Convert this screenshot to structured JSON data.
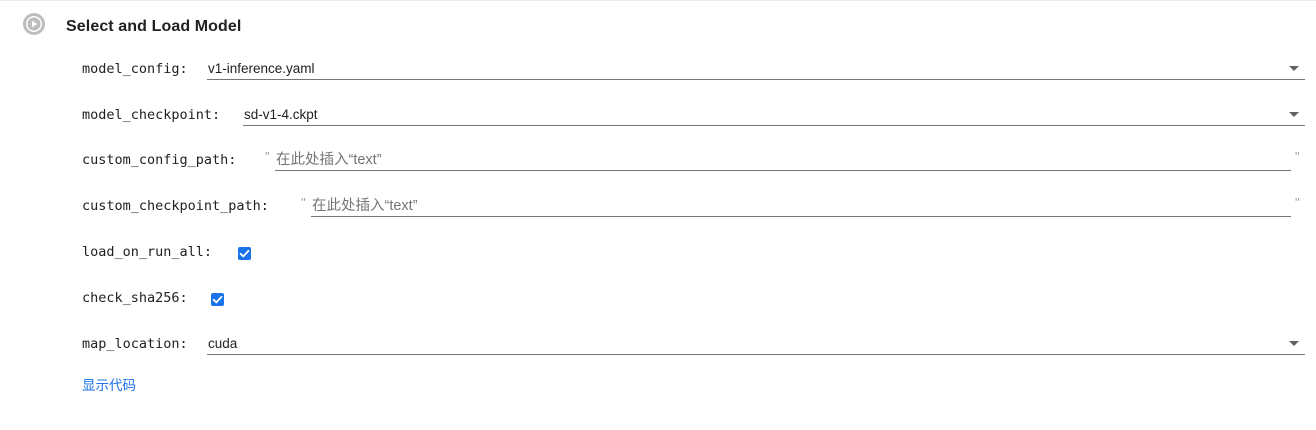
{
  "form": {
    "title": "Select and Load Model",
    "run_icon": "play-circle-icon"
  },
  "fields": {
    "model_config": {
      "label": "model_config:",
      "value": "v1-inference.yaml",
      "dropdown_icon": "caret-down-icon"
    },
    "model_checkpoint": {
      "label": "model_checkpoint:",
      "value": "sd-v1-4.ckpt",
      "dropdown_icon": "caret-down-icon"
    },
    "custom_config_path": {
      "label": "custom_config_path:",
      "value": "",
      "placeholder": "在此处插入“text”",
      "open_quote": "\"",
      "close_quote": "\""
    },
    "custom_checkpoint_path": {
      "label": "custom_checkpoint_path:",
      "value": "",
      "placeholder": "在此处插入“text”",
      "open_quote": "\"",
      "close_quote": "\""
    },
    "load_on_run_all": {
      "label": "load_on_run_all:",
      "checked": true
    },
    "check_sha256": {
      "label": "check_sha256:",
      "checked": true
    },
    "map_location": {
      "label": "map_location:",
      "value": "cuda",
      "dropdown_icon": "caret-down-icon"
    }
  },
  "show_code_link": "显示代码",
  "colors": {
    "accent": "#1a73e8",
    "run_button": "#bdbdbd",
    "text": "#212121",
    "placeholder": "#757575"
  }
}
